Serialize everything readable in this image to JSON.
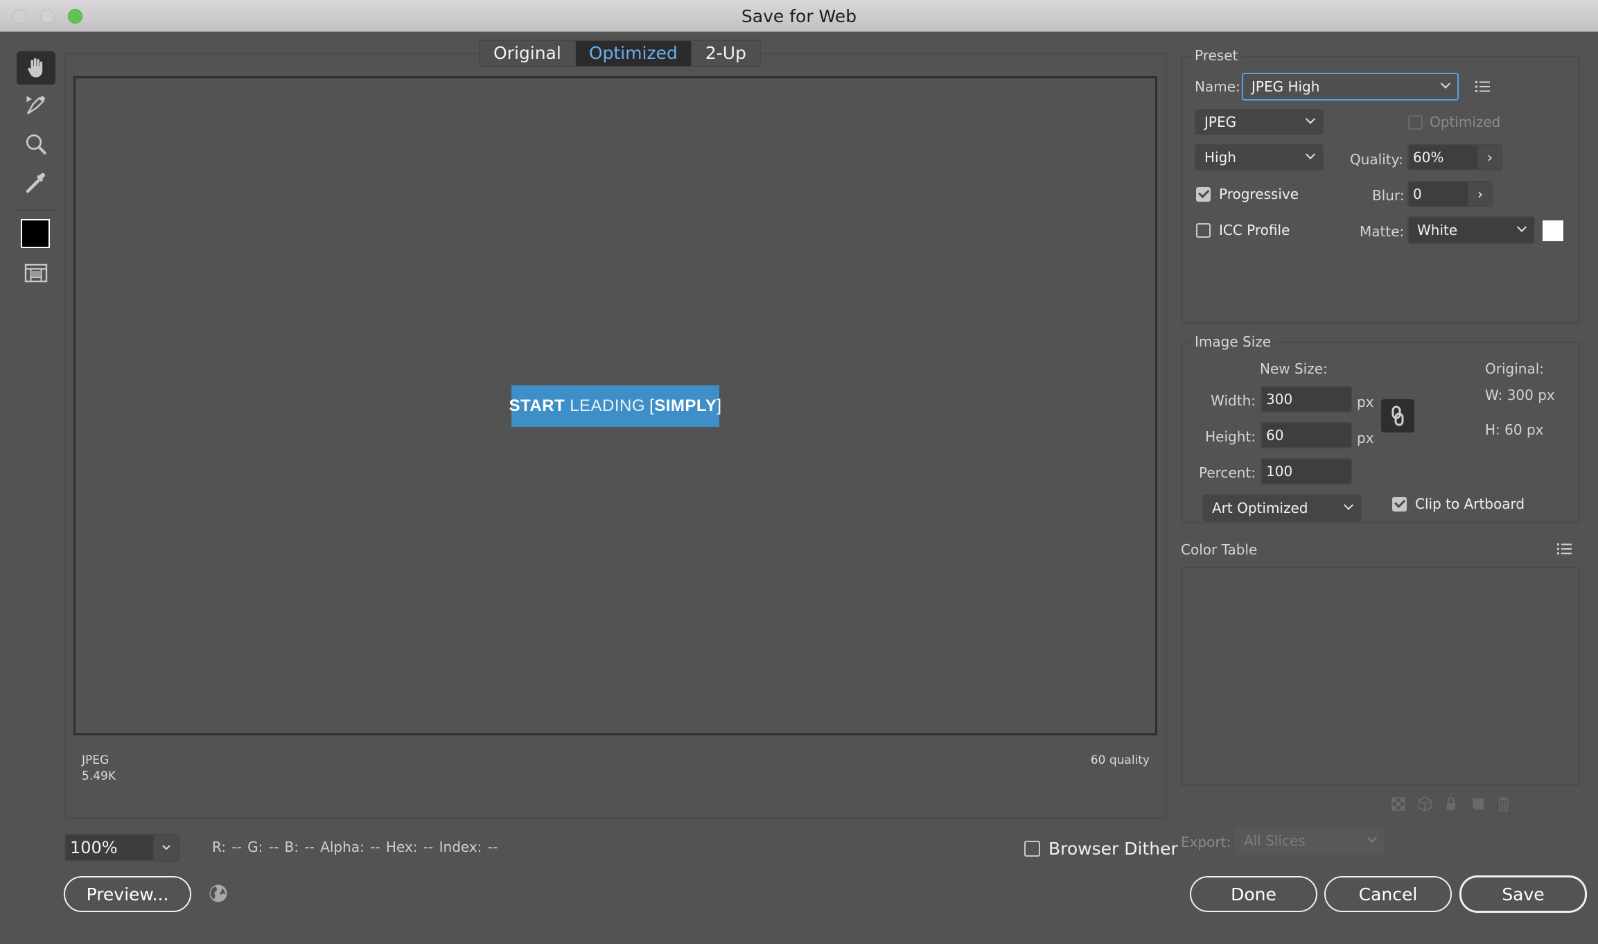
{
  "window": {
    "title": "Save for Web"
  },
  "view_tabs": [
    {
      "label": "Original",
      "active": false
    },
    {
      "label": "Optimized",
      "active": true
    },
    {
      "label": "2-Up",
      "active": false
    }
  ],
  "tools": [
    {
      "name": "hand-tool",
      "icon": "hand-icon",
      "active": true
    },
    {
      "name": "slice-select-tool",
      "icon": "slice-select-icon",
      "active": false
    },
    {
      "name": "zoom-tool",
      "icon": "magnifier-icon",
      "active": false
    },
    {
      "name": "eyedropper-tool",
      "icon": "eyedropper-icon",
      "active": false
    },
    {
      "name": "eyedropper-color",
      "icon": "color-swatch",
      "color": "#000000"
    },
    {
      "name": "toggle-slices-visibility",
      "icon": "slices-visibility-icon",
      "active": false
    }
  ],
  "preview": {
    "banner": {
      "word1": "START",
      "word2": "LEADING",
      "bracket_open": "[",
      "word3": "SIMPLY",
      "bracket_close": "]",
      "bg_color": "#3e8fc7"
    },
    "info_left_format": "JPEG",
    "info_left_size": "5.49K",
    "info_right_quality": "60 quality"
  },
  "bottom_bar": {
    "zoom_value": "100%",
    "pixel_readout": "R: --  G: --  B: --  Alpha: --  Hex: --  Index: --",
    "browser_dither_label": "Browser Dither",
    "browser_dither_checked": false,
    "preview_button": "Preview...",
    "browser_icon": "globe-icon"
  },
  "preset": {
    "group_title": "Preset",
    "name_label": "Name:",
    "name_value": "JPEG High",
    "format_value": "JPEG",
    "optimized_label": "Optimized",
    "optimized_checked": false,
    "compression_value": "High",
    "quality_label": "Quality:",
    "quality_value": "60%",
    "progressive_label": "Progressive",
    "progressive_checked": true,
    "blur_label": "Blur:",
    "blur_value": "0",
    "icc_label": "ICC Profile",
    "icc_checked": false,
    "matte_label": "Matte:",
    "matte_value": "White",
    "matte_color": "#ffffff"
  },
  "image_size": {
    "group_title": "Image Size",
    "new_size_label": "New Size:",
    "width_label": "Width:",
    "width_value": "300",
    "height_label": "Height:",
    "height_value": "60",
    "percent_label": "Percent:",
    "percent_value": "100",
    "unit": "px",
    "original_label": "Original:",
    "original_w": "W:  300 px",
    "original_h": "H:   60 px",
    "resample_value": "Art Optimized",
    "clip_label": "Clip to Artboard",
    "clip_checked": true
  },
  "color_table": {
    "title": "Color Table"
  },
  "export": {
    "label": "Export:",
    "value": "All Slices"
  },
  "actions": {
    "done": "Done",
    "cancel": "Cancel",
    "save": "Save"
  }
}
